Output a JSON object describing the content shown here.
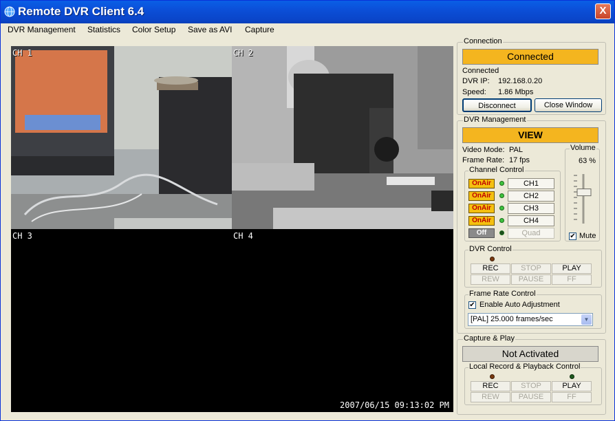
{
  "window": {
    "title": "Remote DVR Client 6.4",
    "close_label": "X"
  },
  "menu": [
    "DVR Management",
    "Statistics",
    "Color Setup",
    "Save as AVI",
    "Capture"
  ],
  "video": {
    "channels": [
      "CH 1",
      "CH 2",
      "CH 3",
      "CH 4"
    ],
    "timestamp": "2007/06/15  09:13:02  PM"
  },
  "connection": {
    "title": "Connection",
    "status": "Connected",
    "state_text": "Connected",
    "ip_label": "DVR IP:",
    "ip": "192.168.0.20",
    "speed_label": "Speed:",
    "speed": "1.86 Mbps",
    "disconnect_label": "Disconnect",
    "close_label": "Close Window"
  },
  "dvr_management": {
    "title": "DVR Management",
    "status": "VIEW",
    "video_mode_label": "Video Mode:",
    "video_mode": "PAL",
    "frame_rate_label": "Frame Rate:",
    "frame_rate": "17 fps",
    "volume": {
      "title": "Volume",
      "value_text": "63 %",
      "level": 0.63,
      "mute_label": "Mute",
      "muted": true
    },
    "channel_control": {
      "title": "Channel Control",
      "rows": [
        {
          "state": "OnAir",
          "channel": "CH1"
        },
        {
          "state": "OnAir",
          "channel": "CH2"
        },
        {
          "state": "OnAir",
          "channel": "CH3"
        },
        {
          "state": "OnAir",
          "channel": "CH4"
        },
        {
          "state": "Off",
          "channel": "Quad"
        }
      ]
    },
    "dvr_control": {
      "title": "DVR Control",
      "buttons": [
        "REC",
        "STOP",
        "PLAY",
        "REW",
        "PAUSE",
        "FF"
      ]
    },
    "frame_rate_control": {
      "title": "Frame Rate Control",
      "auto_label": "Enable Auto Adjustment",
      "auto_checked": true,
      "selected": "[PAL] 25.000 frames/sec"
    }
  },
  "capture_play": {
    "title": "Capture & Play",
    "status": "Not Activated",
    "local_title": "Local Record & Playback Control",
    "buttons": [
      "REC",
      "STOP",
      "PLAY",
      "REW",
      "PAUSE",
      "FF"
    ]
  },
  "colors": {
    "accent": "#f4b51f",
    "titlebar": "#0a5fe6",
    "window_bg": "#ece9d8"
  }
}
